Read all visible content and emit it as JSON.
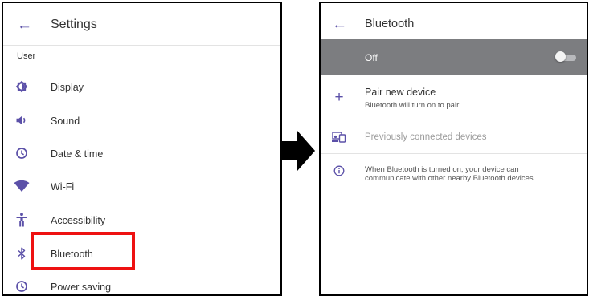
{
  "settings": {
    "title": "Settings",
    "section_label": "User",
    "items": [
      {
        "label": "Display",
        "icon": "display-icon"
      },
      {
        "label": "Sound",
        "icon": "sound-icon"
      },
      {
        "label": "Date & time",
        "icon": "clock-icon"
      },
      {
        "label": "Wi-Fi",
        "icon": "wifi-icon"
      },
      {
        "label": "Accessibility",
        "icon": "accessibility-icon"
      },
      {
        "label": "Bluetooth",
        "icon": "bluetooth-icon"
      },
      {
        "label": "Power saving",
        "icon": "power-saving-icon"
      }
    ],
    "highlighted_item": "Bluetooth"
  },
  "bluetooth": {
    "title": "Bluetooth",
    "toggle": {
      "label": "Off",
      "state": "off"
    },
    "pair": {
      "title": "Pair new device",
      "subtitle": "Bluetooth will turn on to pair"
    },
    "previous_devices_label": "Previously connected devices",
    "info_line1": "When Bluetooth is turned on, your device can",
    "info_line2": "communicate with other nearby Bluetooth devices."
  },
  "colors": {
    "accent": "#5b50a8",
    "highlight": "#ee1111",
    "toggle_bar": "#7c7d80",
    "muted_text": "#9c9c9c"
  }
}
